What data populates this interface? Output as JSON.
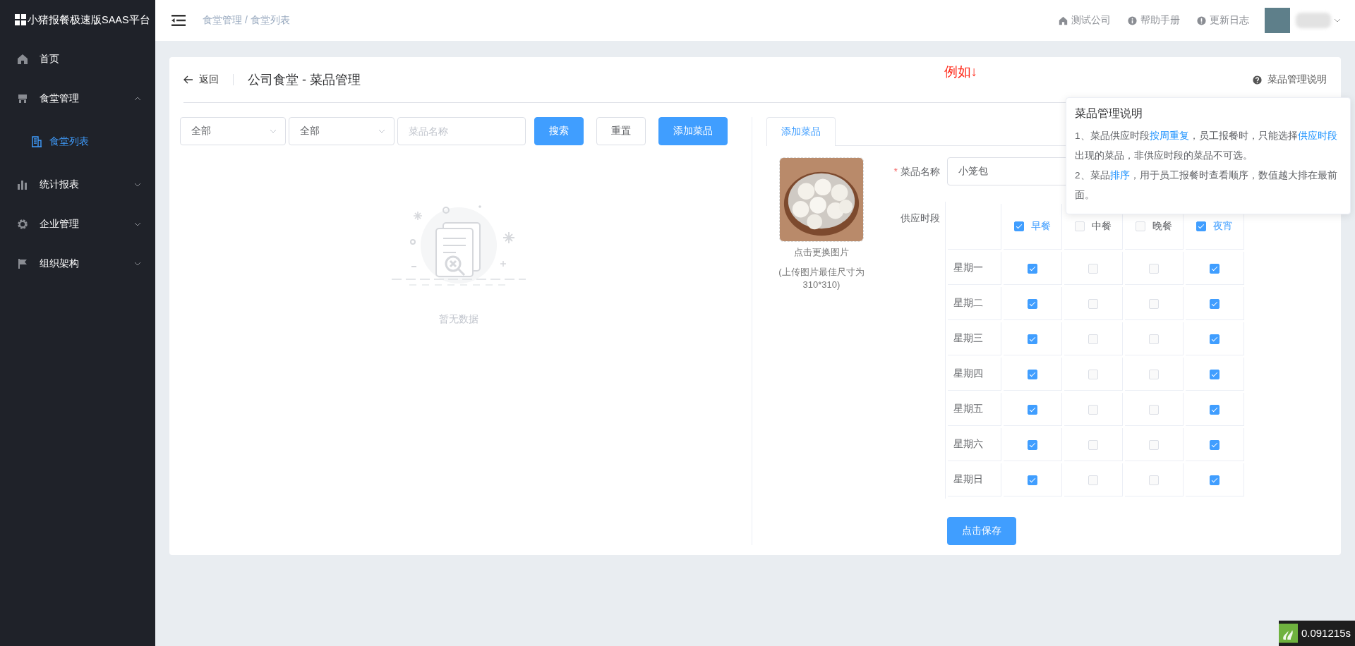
{
  "sidebar": {
    "logo": "小猪报餐极速版SAAS平台",
    "items": [
      {
        "label": "首页"
      },
      {
        "label": "食堂管理",
        "expanded": true,
        "children": [
          {
            "label": "食堂列表",
            "selected": true
          }
        ]
      },
      {
        "label": "统计报表",
        "expanded": false
      },
      {
        "label": "企业管理",
        "expanded": false
      },
      {
        "label": "组织架构",
        "expanded": false
      }
    ]
  },
  "topbar": {
    "breadcrumb": "食堂管理 / 食堂列表",
    "links": [
      {
        "label": "测试公司"
      },
      {
        "label": "帮助手册"
      },
      {
        "label": "更新日志"
      }
    ]
  },
  "card": {
    "back": "返回",
    "title": "公司食堂 - 菜品管理",
    "note": "例如↓",
    "help": "菜品管理说明"
  },
  "filters": {
    "selects": [
      "全部",
      "全部"
    ],
    "search_placeholder": "菜品名称",
    "buttons": [
      {
        "label": "搜索",
        "kind": "primary"
      },
      {
        "label": "重置",
        "kind": "default"
      },
      {
        "label": "添加菜品",
        "kind": "primary"
      }
    ]
  },
  "empty_text": "暂无数据",
  "editor": {
    "tabs": [
      {
        "label": "添加菜品",
        "selected": true
      }
    ],
    "image_caption": "点击更换图片",
    "image_hint": "(上传图片最佳尺寸为310*310)",
    "name_field": {
      "required_mark": "*",
      "label": "菜品名称",
      "value": "小笼包"
    },
    "schedule": {
      "label": "供应时段",
      "meals": [
        {
          "label": "早餐",
          "checked": true
        },
        {
          "label": "中餐",
          "checked": false
        },
        {
          "label": "晚餐",
          "checked": false
        },
        {
          "label": "夜宵",
          "checked": true
        }
      ],
      "days": [
        {
          "label": "星期一",
          "checks": [
            true,
            false,
            false,
            true
          ]
        },
        {
          "label": "星期二",
          "checks": [
            true,
            false,
            false,
            true
          ]
        },
        {
          "label": "星期三",
          "checks": [
            true,
            false,
            false,
            true
          ]
        },
        {
          "label": "星期四",
          "checks": [
            true,
            false,
            false,
            true
          ]
        },
        {
          "label": "星期五",
          "checks": [
            true,
            false,
            false,
            true
          ]
        },
        {
          "label": "星期六",
          "checks": [
            true,
            false,
            false,
            true
          ]
        },
        {
          "label": "星期日",
          "checks": [
            true,
            false,
            false,
            true
          ]
        }
      ]
    },
    "save": "点击保存"
  },
  "tooltip": {
    "title": "菜品管理说明",
    "paragraphs": [
      [
        {
          "text": "1、菜品供应时段"
        },
        {
          "text": "按周重复",
          "highlight": true
        },
        {
          "text": "，员工报餐时，只能选择"
        },
        {
          "text": "供应时段",
          "highlight": true
        },
        {
          "text": "出现的菜品，非供应时段的菜品不可选。"
        }
      ],
      [
        {
          "text": "2、菜品"
        },
        {
          "text": "排序",
          "highlight": true
        },
        {
          "text": "，用于员工报餐时查看顺序，数值越大排在最前面。"
        }
      ]
    ]
  },
  "timer": "0.091215s"
}
